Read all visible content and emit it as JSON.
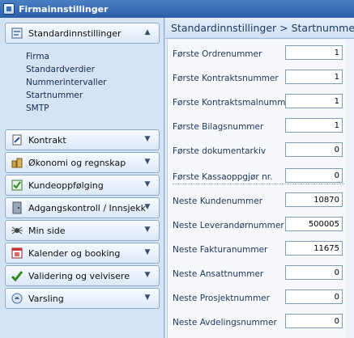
{
  "window": {
    "title": "Firmainnstillinger"
  },
  "sidebar": {
    "groups": [
      {
        "label": "Standardinnstillinger",
        "icon": "settings-book-icon",
        "expanded": true
      },
      {
        "label": "Kontrakt",
        "icon": "contract-icon"
      },
      {
        "label": "Økonomi og regnskap",
        "icon": "coins-icon"
      },
      {
        "label": "Kundeoppfølging",
        "icon": "customer-followup-icon"
      },
      {
        "label": "Adgangskontroll / Innsjekk",
        "icon": "door-icon"
      },
      {
        "label": "Min side",
        "icon": "spider-icon"
      },
      {
        "label": "Kalender og booking",
        "icon": "calendar-icon"
      },
      {
        "label": "Validering og veivisere",
        "icon": "checkmark-icon"
      },
      {
        "label": "Varsling",
        "icon": "notification-icon"
      }
    ],
    "subitems": [
      "Firma",
      "Standardverdier",
      "Nummerintervaller",
      "Startnummer",
      "SMTP"
    ]
  },
  "main": {
    "header": "Standardinnstillinger > Startnummer",
    "fields": [
      {
        "label": "Første Ordrenummer",
        "value": "1"
      },
      {
        "label": "Første Kontraktsnummer",
        "value": "1"
      },
      {
        "label": "Første Kontraktsmalnummer",
        "value": "1"
      },
      {
        "label": "Første Bilagsnummer",
        "value": "1"
      },
      {
        "label": "Første dokumentarkiv",
        "value": "0"
      },
      {
        "label": "Første Kassaoppgjør nr.",
        "value": "0"
      },
      {
        "label": "Neste Kundenummer",
        "value": "10870"
      },
      {
        "label": "Neste Leverandørnummer",
        "value": "500005"
      },
      {
        "label": "Neste Fakturanummer",
        "value": "11675"
      },
      {
        "label": "Neste Ansattnummer",
        "value": "0"
      },
      {
        "label": "Neste Prosjektnummer",
        "value": "0"
      },
      {
        "label": "Neste Avdelingsnummer",
        "value": "0"
      }
    ]
  }
}
